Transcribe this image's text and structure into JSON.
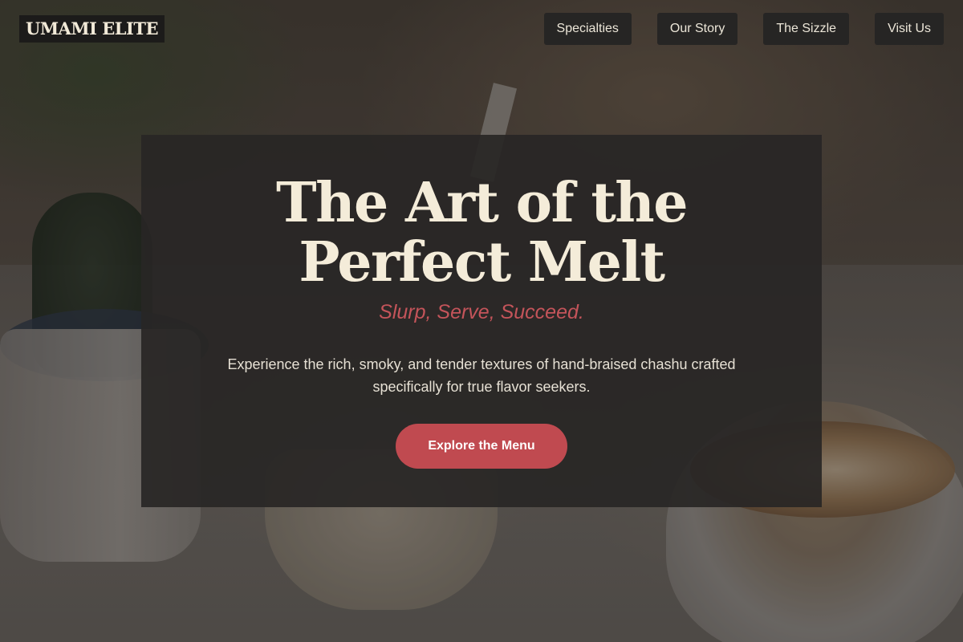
{
  "header": {
    "logo": "UMAMI ELITE",
    "nav": [
      "Specialties",
      "Our Story",
      "The Sizzle",
      "Visit Us"
    ]
  },
  "hero": {
    "title": "The Art of the Perfect Melt",
    "tagline": "Slurp, Serve, Succeed.",
    "description": "Experience the rich, smoky, and tender textures of hand-braised chashu crafted specifically for true flavor seekers.",
    "cta_label": "Explore the Menu"
  },
  "colors": {
    "accent": "#c04a50",
    "title": "#f4ecd9",
    "panel": "#282625"
  }
}
